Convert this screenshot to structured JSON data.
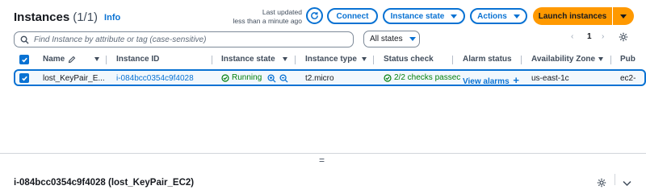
{
  "header": {
    "title": "Instances",
    "count": "(1/1)",
    "info": "Info",
    "last_updated_line1": "Last updated",
    "last_updated_line2": "less than a minute ago"
  },
  "toolbar": {
    "connect": "Connect",
    "instance_state": "Instance state",
    "actions": "Actions",
    "launch": "Launch instances"
  },
  "filter": {
    "search_placeholder": "Find Instance by attribute or tag (case-sensitive)",
    "states_value": "All states"
  },
  "pagination": {
    "current": "1",
    "prev": "‹",
    "next": "›"
  },
  "table": {
    "columns": [
      "Name",
      "Instance ID",
      "Instance state",
      "Instance type",
      "Status check",
      "Alarm status",
      "Availability Zone",
      "Pub"
    ],
    "row": {
      "name": "lost_KeyPair_E...",
      "instance_id": "i-084bcc0354c9f4028",
      "state": "Running",
      "type": "t2.micro",
      "status_check": "2/2 checks passec",
      "alarm_status": "View alarms",
      "availability_zone": "us-east-1c",
      "public": "ec2-"
    }
  },
  "detail": {
    "handle": "=",
    "title": "i-084bcc0354c9f4028 (lost_KeyPair_EC2)"
  },
  "colors": {
    "accent": "#0972d3",
    "primary_button": "#ff9900",
    "success": "#037f0c"
  }
}
